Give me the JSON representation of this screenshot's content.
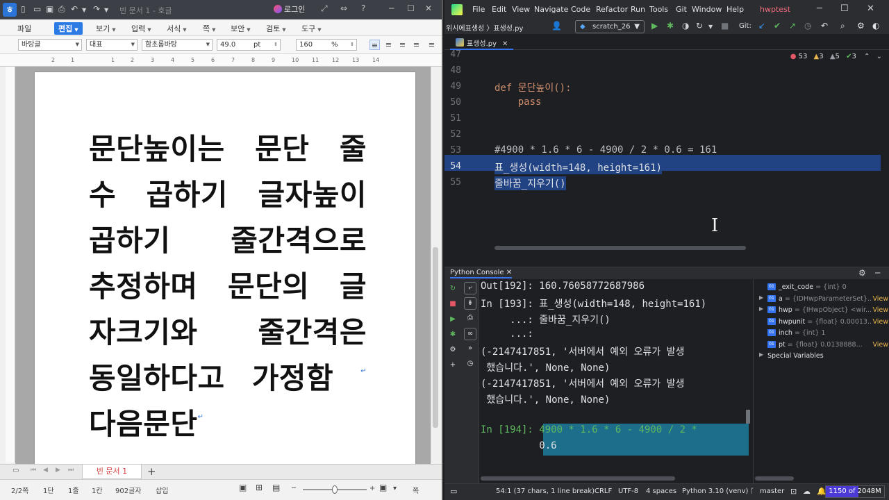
{
  "hwp": {
    "title_bar": {
      "doc_title": "빈 문서 1 - 호글",
      "login": "로그인",
      "help": "?"
    },
    "menu": [
      {
        "label": "파일",
        "active": false
      },
      {
        "label": "편집",
        "active": true
      },
      {
        "label": "보기",
        "active": false
      },
      {
        "label": "입력",
        "active": false
      },
      {
        "label": "서식",
        "active": false
      },
      {
        "label": "쪽",
        "active": false
      },
      {
        "label": "보안",
        "active": false
      },
      {
        "label": "검토",
        "active": false
      },
      {
        "label": "도구",
        "active": false
      }
    ],
    "format_bar": {
      "style": "바탕글",
      "font_category": "대표",
      "font_name": "함초롬바탕",
      "font_size": "49.0",
      "size_unit": "pt",
      "line_spacing": "160",
      "spacing_unit": "%"
    },
    "ruler_ticks": [
      "2",
      "1",
      "1",
      "2",
      "3",
      "4",
      "5",
      "6",
      "7",
      "8",
      "9",
      "10",
      "11",
      "12",
      "13",
      "14"
    ],
    "document_lines": [
      [
        "문단높이는",
        "문단",
        "줄"
      ],
      [
        "수",
        "곱하기",
        "글자높이"
      ],
      [
        "곱하기",
        "줄간격으로"
      ],
      [
        "추정하며",
        "문단의",
        "글"
      ],
      [
        "자크기와",
        "줄간격은"
      ],
      [
        "동일하다고",
        "가정함"
      ],
      [
        "다음문단"
      ]
    ],
    "doc_tab": "빈 문서 1",
    "status": {
      "page": "2/2쪽",
      "section": "1단",
      "line": "1줄",
      "col": "1칸",
      "chars": "902글자",
      "mode": "삽입",
      "zoom_label": "쪽"
    }
  },
  "pycharm": {
    "menu": [
      "File",
      "Edit",
      "View",
      "Navigate",
      "Code",
      "Refactor",
      "Run",
      "Tools",
      "Git",
      "Window",
      "Help"
    ],
    "project": "hwptest",
    "breadcrumb": "위시에표생성 〉표생성.py",
    "run_config": "scratch_26",
    "git_label": "Git:",
    "file_tab": "표생성.py",
    "inspections": {
      "errors": "53",
      "warnings": "3",
      "weak": "5",
      "ok": "3"
    },
    "editor_lines": [
      {
        "n": "47",
        "code": ""
      },
      {
        "n": "48",
        "code": ""
      },
      {
        "n": "49",
        "code": "def 문단높이():"
      },
      {
        "n": "50",
        "code": "    pass"
      },
      {
        "n": "51",
        "code": ""
      },
      {
        "n": "52",
        "code": ""
      },
      {
        "n": "53",
        "code": "#4900 * 1.6 * 6 - 4900 / 2 * 0.6 = 161"
      },
      {
        "n": "54",
        "code": "표_생성(width=148, height=161)"
      },
      {
        "n": "55",
        "code": "줄바꿈_지우기()"
      }
    ],
    "console_title": "Python Console",
    "console_lines": [
      "Out[192]: 160.76058772687986",
      "In [193]: 표_생성(width=148, height=161)",
      "     ...: 줄바꿈_지우기()",
      "     ...:",
      "(-2147417851, '서버에서 예외 오류가 발생",
      " 했습니다.', None, None)",
      "(-2147417851, '서버에서 예외 오류가 발생",
      " 했습니다.', None, None)",
      "",
      "In [194]: 4900 * 1.6 * 6 - 4900 / 2 * ",
      "          0.6"
    ],
    "variables": [
      {
        "name": "_exit_code",
        "type": "= {int} 0",
        "view": "",
        "expandable": false
      },
      {
        "name": "a",
        "type": "= {IDHwpParameterSet}...",
        "view": "View",
        "expandable": true
      },
      {
        "name": "hwp",
        "type": "= {IHwpObject} <wir...",
        "view": "View",
        "expandable": true
      },
      {
        "name": "hwpunit",
        "type": "= {float} 0.00013...",
        "view": "View",
        "expandable": false
      },
      {
        "name": "inch",
        "type": "= {int} 1",
        "view": "",
        "expandable": false
      },
      {
        "name": "pt",
        "type": "= {float} 0.0138888...",
        "view": "View",
        "expandable": false
      },
      {
        "name": "Special Variables",
        "type": "",
        "view": "",
        "expandable": true
      }
    ],
    "status": {
      "position": "54:1 (37 chars, 1 line break)",
      "line_sep": "CRLF",
      "encoding": "UTF-8",
      "indent": "4 spaces",
      "interpreter": "Python 3.10 (venv)",
      "branch": "master",
      "memory": "1150 of 2048M",
      "memory_used_mb": 1150,
      "memory_total_mb": 2048
    }
  },
  "colors": {
    "hwp_active_menu": "#2c7be5",
    "pyc_selection": "#214283",
    "pyc_keyword": "#cf8e6d",
    "pyc_number": "#2aacb8",
    "pyc_param": "#aa4926",
    "memory_fill": "#4c3ad6"
  }
}
